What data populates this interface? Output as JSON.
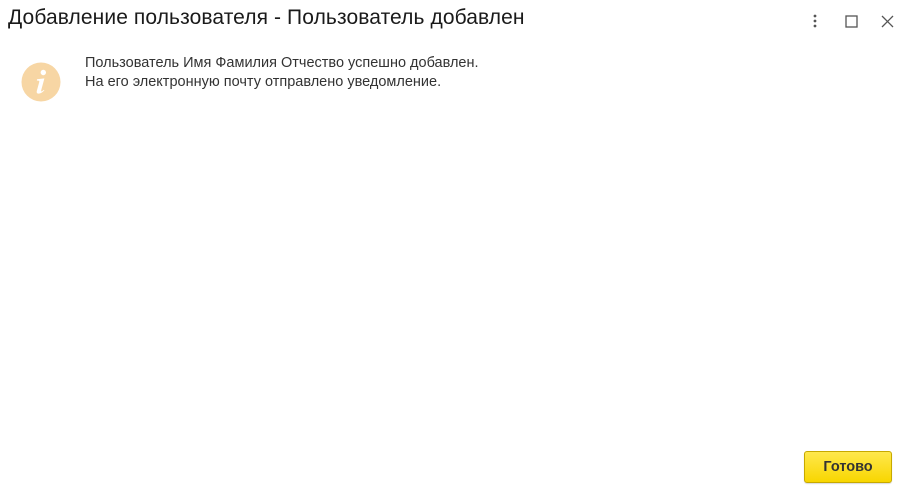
{
  "window": {
    "title": "Добавление пользователя - Пользователь добавлен"
  },
  "controls": {
    "more_icon": "more-vertical-icon",
    "maximize_icon": "maximize-icon",
    "close_icon": "close-icon"
  },
  "message": {
    "icon": "info-icon",
    "icon_color": "#f7d6a4",
    "line1": "Пользователь Имя Фамилия Отчество успешно добавлен.",
    "line2": "На его электронную почту отправлено уведомление."
  },
  "footer": {
    "done_label": "Готово",
    "done_color": "#f8d600"
  }
}
